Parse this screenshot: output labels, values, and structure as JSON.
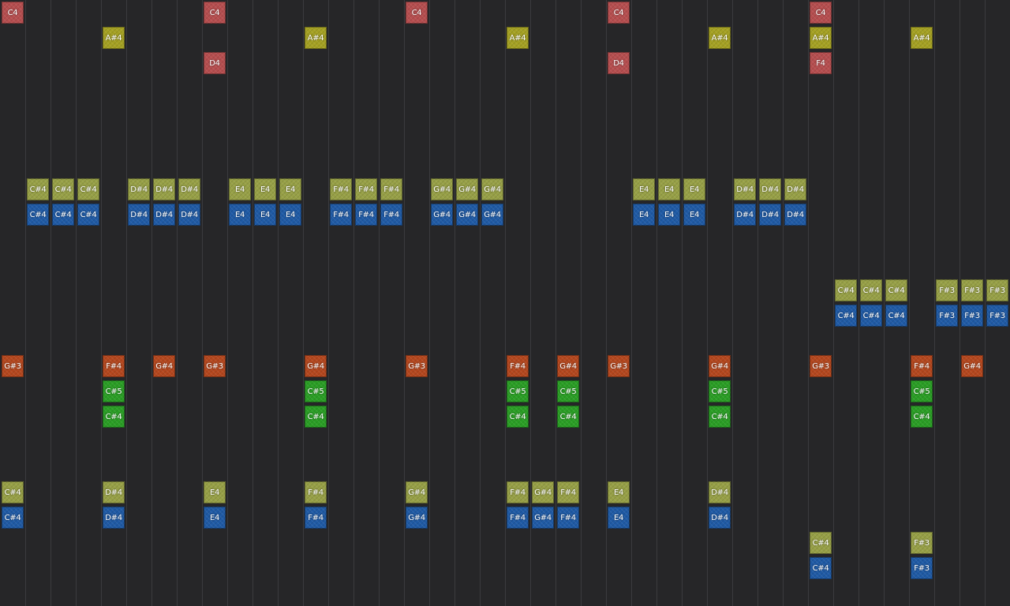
{
  "colors": {
    "red": "#b64e4f",
    "yellow": "#a5a123",
    "olive": "#97a046",
    "blue": "#1f5aa5",
    "orange": "#b4471e",
    "green": "#2a9e25"
  },
  "notes": [
    {
      "label": "C4",
      "color": "red",
      "col": 0,
      "row": 0
    },
    {
      "label": "C4",
      "color": "red",
      "col": 8,
      "row": 0
    },
    {
      "label": "C4",
      "color": "red",
      "col": 16,
      "row": 0
    },
    {
      "label": "C4",
      "color": "red",
      "col": 24,
      "row": 0
    },
    {
      "label": "C4",
      "color": "red",
      "col": 32,
      "row": 0
    },
    {
      "label": "A#4",
      "color": "yellow",
      "col": 4,
      "row": 1
    },
    {
      "label": "A#4",
      "color": "yellow",
      "col": 12,
      "row": 1
    },
    {
      "label": "A#4",
      "color": "yellow",
      "col": 20,
      "row": 1
    },
    {
      "label": "A#4",
      "color": "yellow",
      "col": 28,
      "row": 1
    },
    {
      "label": "A#4",
      "color": "yellow",
      "col": 32,
      "row": 1
    },
    {
      "label": "A#4",
      "color": "yellow",
      "col": 36,
      "row": 1
    },
    {
      "label": "D4",
      "color": "red",
      "col": 8,
      "row": 2
    },
    {
      "label": "D4",
      "color": "red",
      "col": 24,
      "row": 2
    },
    {
      "label": "F4",
      "color": "red",
      "col": 32,
      "row": 2
    },
    {
      "label": "C#4",
      "color": "olive",
      "col": 1,
      "row": 7
    },
    {
      "label": "C#4",
      "color": "olive",
      "col": 2,
      "row": 7
    },
    {
      "label": "C#4",
      "color": "olive",
      "col": 3,
      "row": 7
    },
    {
      "label": "D#4",
      "color": "olive",
      "col": 5,
      "row": 7
    },
    {
      "label": "D#4",
      "color": "olive",
      "col": 6,
      "row": 7
    },
    {
      "label": "D#4",
      "color": "olive",
      "col": 7,
      "row": 7
    },
    {
      "label": "E4",
      "color": "olive",
      "col": 9,
      "row": 7
    },
    {
      "label": "E4",
      "color": "olive",
      "col": 10,
      "row": 7
    },
    {
      "label": "E4",
      "color": "olive",
      "col": 11,
      "row": 7
    },
    {
      "label": "F#4",
      "color": "olive",
      "col": 13,
      "row": 7
    },
    {
      "label": "F#4",
      "color": "olive",
      "col": 14,
      "row": 7
    },
    {
      "label": "F#4",
      "color": "olive",
      "col": 15,
      "row": 7
    },
    {
      "label": "G#4",
      "color": "olive",
      "col": 17,
      "row": 7
    },
    {
      "label": "G#4",
      "color": "olive",
      "col": 18,
      "row": 7
    },
    {
      "label": "G#4",
      "color": "olive",
      "col": 19,
      "row": 7
    },
    {
      "label": "E4",
      "color": "olive",
      "col": 25,
      "row": 7
    },
    {
      "label": "E4",
      "color": "olive",
      "col": 26,
      "row": 7
    },
    {
      "label": "E4",
      "color": "olive",
      "col": 27,
      "row": 7
    },
    {
      "label": "D#4",
      "color": "olive",
      "col": 29,
      "row": 7
    },
    {
      "label": "D#4",
      "color": "olive",
      "col": 30,
      "row": 7
    },
    {
      "label": "D#4",
      "color": "olive",
      "col": 31,
      "row": 7
    },
    {
      "label": "C#4",
      "color": "blue",
      "col": 1,
      "row": 8
    },
    {
      "label": "C#4",
      "color": "blue",
      "col": 2,
      "row": 8
    },
    {
      "label": "C#4",
      "color": "blue",
      "col": 3,
      "row": 8
    },
    {
      "label": "D#4",
      "color": "blue",
      "col": 5,
      "row": 8
    },
    {
      "label": "D#4",
      "color": "blue",
      "col": 6,
      "row": 8
    },
    {
      "label": "D#4",
      "color": "blue",
      "col": 7,
      "row": 8
    },
    {
      "label": "E4",
      "color": "blue",
      "col": 9,
      "row": 8
    },
    {
      "label": "E4",
      "color": "blue",
      "col": 10,
      "row": 8
    },
    {
      "label": "E4",
      "color": "blue",
      "col": 11,
      "row": 8
    },
    {
      "label": "F#4",
      "color": "blue",
      "col": 13,
      "row": 8
    },
    {
      "label": "F#4",
      "color": "blue",
      "col": 14,
      "row": 8
    },
    {
      "label": "F#4",
      "color": "blue",
      "col": 15,
      "row": 8
    },
    {
      "label": "G#4",
      "color": "blue",
      "col": 17,
      "row": 8
    },
    {
      "label": "G#4",
      "color": "blue",
      "col": 18,
      "row": 8
    },
    {
      "label": "G#4",
      "color": "blue",
      "col": 19,
      "row": 8
    },
    {
      "label": "E4",
      "color": "blue",
      "col": 25,
      "row": 8
    },
    {
      "label": "E4",
      "color": "blue",
      "col": 26,
      "row": 8
    },
    {
      "label": "E4",
      "color": "blue",
      "col": 27,
      "row": 8
    },
    {
      "label": "D#4",
      "color": "blue",
      "col": 29,
      "row": 8
    },
    {
      "label": "D#4",
      "color": "blue",
      "col": 30,
      "row": 8
    },
    {
      "label": "D#4",
      "color": "blue",
      "col": 31,
      "row": 8
    },
    {
      "label": "C#4",
      "color": "olive",
      "col": 33,
      "row": 11
    },
    {
      "label": "C#4",
      "color": "olive",
      "col": 34,
      "row": 11
    },
    {
      "label": "C#4",
      "color": "olive",
      "col": 35,
      "row": 11
    },
    {
      "label": "F#3",
      "color": "olive",
      "col": 37,
      "row": 11
    },
    {
      "label": "F#3",
      "color": "olive",
      "col": 38,
      "row": 11
    },
    {
      "label": "F#3",
      "color": "olive",
      "col": 39,
      "row": 11
    },
    {
      "label": "C#4",
      "color": "blue",
      "col": 33,
      "row": 12
    },
    {
      "label": "C#4",
      "color": "blue",
      "col": 34,
      "row": 12
    },
    {
      "label": "C#4",
      "color": "blue",
      "col": 35,
      "row": 12
    },
    {
      "label": "F#3",
      "color": "blue",
      "col": 37,
      "row": 12
    },
    {
      "label": "F#3",
      "color": "blue",
      "col": 38,
      "row": 12
    },
    {
      "label": "F#3",
      "color": "blue",
      "col": 39,
      "row": 12
    },
    {
      "label": "G#3",
      "color": "orange",
      "col": 0,
      "row": 14
    },
    {
      "label": "F#4",
      "color": "orange",
      "col": 4,
      "row": 14
    },
    {
      "label": "G#4",
      "color": "orange",
      "col": 6,
      "row": 14
    },
    {
      "label": "G#3",
      "color": "orange",
      "col": 8,
      "row": 14
    },
    {
      "label": "G#4",
      "color": "orange",
      "col": 12,
      "row": 14
    },
    {
      "label": "G#3",
      "color": "orange",
      "col": 16,
      "row": 14
    },
    {
      "label": "F#4",
      "color": "orange",
      "col": 20,
      "row": 14
    },
    {
      "label": "G#4",
      "color": "orange",
      "col": 22,
      "row": 14
    },
    {
      "label": "G#3",
      "color": "orange",
      "col": 24,
      "row": 14
    },
    {
      "label": "G#4",
      "color": "orange",
      "col": 28,
      "row": 14
    },
    {
      "label": "G#3",
      "color": "orange",
      "col": 32,
      "row": 14
    },
    {
      "label": "F#4",
      "color": "orange",
      "col": 36,
      "row": 14
    },
    {
      "label": "G#4",
      "color": "orange",
      "col": 38,
      "row": 14
    },
    {
      "label": "C#5",
      "color": "green",
      "col": 4,
      "row": 15
    },
    {
      "label": "C#5",
      "color": "green",
      "col": 12,
      "row": 15
    },
    {
      "label": "C#5",
      "color": "green",
      "col": 20,
      "row": 15
    },
    {
      "label": "C#5",
      "color": "green",
      "col": 22,
      "row": 15
    },
    {
      "label": "C#5",
      "color": "green",
      "col": 28,
      "row": 15
    },
    {
      "label": "C#5",
      "color": "green",
      "col": 36,
      "row": 15
    },
    {
      "label": "C#4",
      "color": "green",
      "col": 4,
      "row": 16
    },
    {
      "label": "C#4",
      "color": "green",
      "col": 12,
      "row": 16
    },
    {
      "label": "C#4",
      "color": "green",
      "col": 20,
      "row": 16
    },
    {
      "label": "C#4",
      "color": "green",
      "col": 22,
      "row": 16
    },
    {
      "label": "C#4",
      "color": "green",
      "col": 28,
      "row": 16
    },
    {
      "label": "C#4",
      "color": "green",
      "col": 36,
      "row": 16
    },
    {
      "label": "C#4",
      "color": "olive",
      "col": 0,
      "row": 19
    },
    {
      "label": "D#4",
      "color": "olive",
      "col": 4,
      "row": 19
    },
    {
      "label": "E4",
      "color": "olive",
      "col": 8,
      "row": 19
    },
    {
      "label": "F#4",
      "color": "olive",
      "col": 12,
      "row": 19
    },
    {
      "label": "G#4",
      "color": "olive",
      "col": 16,
      "row": 19
    },
    {
      "label": "F#4",
      "color": "olive",
      "col": 20,
      "row": 19
    },
    {
      "label": "G#4",
      "color": "olive",
      "col": 21,
      "row": 19
    },
    {
      "label": "F#4",
      "color": "olive",
      "col": 22,
      "row": 19
    },
    {
      "label": "E4",
      "color": "olive",
      "col": 24,
      "row": 19
    },
    {
      "label": "D#4",
      "color": "olive",
      "col": 28,
      "row": 19
    },
    {
      "label": "C#4",
      "color": "blue",
      "col": 0,
      "row": 20
    },
    {
      "label": "D#4",
      "color": "blue",
      "col": 4,
      "row": 20
    },
    {
      "label": "E4",
      "color": "blue",
      "col": 8,
      "row": 20
    },
    {
      "label": "F#4",
      "color": "blue",
      "col": 12,
      "row": 20
    },
    {
      "label": "G#4",
      "color": "blue",
      "col": 16,
      "row": 20
    },
    {
      "label": "F#4",
      "color": "blue",
      "col": 20,
      "row": 20
    },
    {
      "label": "G#4",
      "color": "blue",
      "col": 21,
      "row": 20
    },
    {
      "label": "F#4",
      "color": "blue",
      "col": 22,
      "row": 20
    },
    {
      "label": "E4",
      "color": "blue",
      "col": 24,
      "row": 20
    },
    {
      "label": "D#4",
      "color": "blue",
      "col": 28,
      "row": 20
    },
    {
      "label": "C#4",
      "color": "olive",
      "col": 32,
      "row": 21
    },
    {
      "label": "F#3",
      "color": "olive",
      "col": 36,
      "row": 21
    },
    {
      "label": "C#4",
      "color": "blue",
      "col": 32,
      "row": 22
    },
    {
      "label": "F#3",
      "color": "blue",
      "col": 36,
      "row": 22
    }
  ]
}
